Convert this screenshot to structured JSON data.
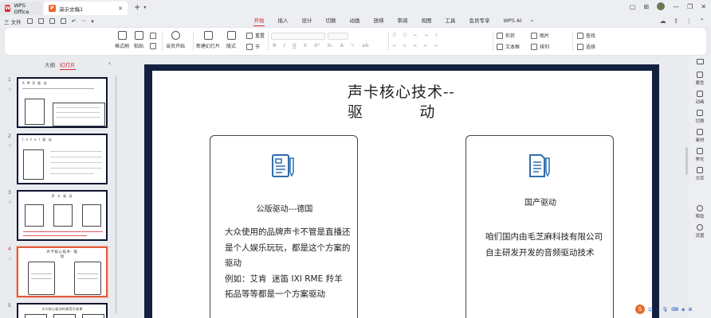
{
  "titlebar": {
    "app_tab": "WPS Office",
    "doc_tab": "演示文稿1",
    "app_logo": "W",
    "doc_logo": "P"
  },
  "menubar": {
    "file_label": "三 文件",
    "tabs": [
      "开始",
      "插入",
      "设计",
      "切换",
      "动画",
      "放映",
      "审阅",
      "视图",
      "工具",
      "会员专享",
      "WPS AI"
    ],
    "active_tab": "开始"
  },
  "toolbar": {
    "format_painter": "格式刷",
    "paste": "粘贴",
    "from_current": "当页开始",
    "new_slide": "新建幻灯片",
    "layout": "版式",
    "section": "节",
    "reset": "重置",
    "shape": "形状",
    "picture": "图片",
    "find": "查找",
    "textbox": "文本框",
    "arrange": "排列",
    "select": "选择"
  },
  "leftpanel": {
    "tab_outline": "大纲",
    "tab_slides": "幻灯片",
    "active_tab": "幻灯片",
    "thumbnails": [
      {
        "num": "1",
        "title": "A M D 驱 动"
      },
      {
        "num": "2",
        "title": "I n t e l 驱 动"
      },
      {
        "num": "3",
        "title": "声 卡 驱 动"
      },
      {
        "num": "4",
        "title": "声卡核心技术- 驱 动"
      },
      {
        "num": "5",
        "title": "大众核心驱动的源音乐效果"
      }
    ],
    "active_slide": "4"
  },
  "slide": {
    "title_line1": "声卡核心技术--",
    "title_line2": "驱          动",
    "left_card": {
      "heading": "公版驱动---德国",
      "body": "大众使用的品牌声卡不管是直播还是个人娱乐玩玩，都是这个方案的驱动\n例如：艾肯  迷笛 IXI RME 羚羊  拓品等等都是一个方案驱动"
    },
    "right_card": {
      "heading": "国产驱动",
      "body": "咱们国内由毛芝麻科技有限公司自主研发开发的音频驱动技术"
    }
  },
  "rightpanel": {
    "items": [
      "属性",
      "动画",
      "切换",
      "素材",
      "美化",
      "文库",
      "帮助",
      "设置"
    ]
  },
  "ime": {
    "logo": "S",
    "label": "中"
  },
  "colors": {
    "accent": "#d7282e",
    "slide_frame": "#14203f",
    "icon_blue": "#2f6fae"
  }
}
